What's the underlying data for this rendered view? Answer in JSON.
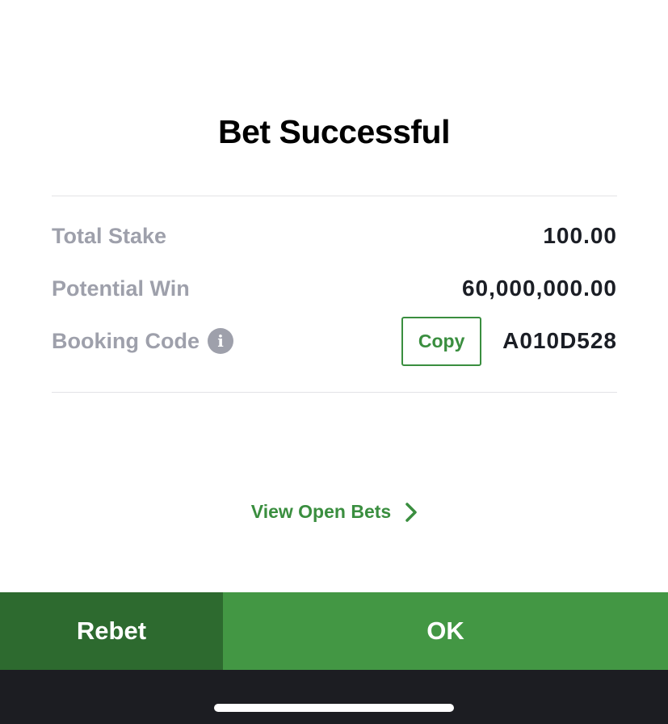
{
  "dialog": {
    "title": "Bet Successful"
  },
  "summary": {
    "total_stake_label": "Total Stake",
    "total_stake_value": "100.00",
    "potential_win_label": "Potential Win",
    "potential_win_value": "60,000,000.00",
    "booking_code_label": "Booking Code",
    "booking_code_info_icon": "info-icon",
    "copy_label": "Copy",
    "booking_code_value": "A010D528"
  },
  "links": {
    "view_open_bets": "View Open Bets",
    "view_open_bets_icon": "chevron-right-icon"
  },
  "footer": {
    "rebet_label": "Rebet",
    "ok_label": "OK"
  },
  "colors": {
    "accent_green": "#3a8e3f",
    "rebet_bg": "#2d6a2f",
    "ok_bg": "#439744",
    "label_gray": "#9ea0ab",
    "home_bar_bg": "#1c1d22"
  }
}
